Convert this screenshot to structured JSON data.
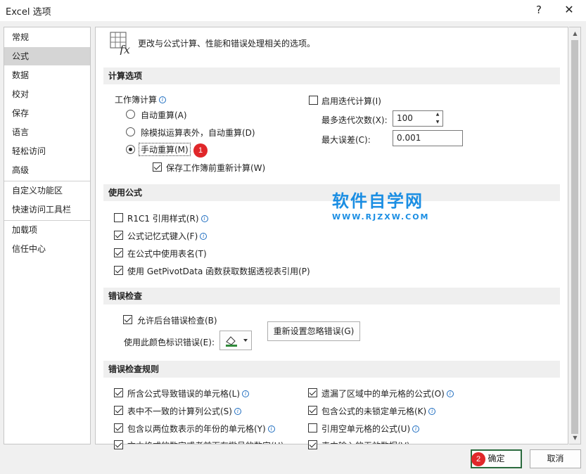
{
  "window": {
    "title": "Excel 选项",
    "help": "?",
    "close": "✕"
  },
  "sidebar": {
    "items": [
      {
        "label": "常规"
      },
      {
        "label": "公式"
      },
      {
        "label": "数据"
      },
      {
        "label": "校对"
      },
      {
        "label": "保存"
      },
      {
        "label": "语言"
      },
      {
        "label": "轻松访问"
      },
      {
        "label": "高级"
      },
      {
        "label": "自定义功能区"
      },
      {
        "label": "快速访问工具栏"
      },
      {
        "label": "加载项"
      },
      {
        "label": "信任中心"
      }
    ],
    "active_index": 1
  },
  "header": {
    "description": "更改与公式计算、性能和错误处理相关的选项。",
    "icon": "formula-fx-icon"
  },
  "calc": {
    "title": "计算选项",
    "workbook_label": "工作簿计算",
    "radio_auto": "自动重算(A)",
    "radio_auto_except": "除模拟运算表外，自动重算(D)",
    "radio_manual": "手动重算(M)",
    "selected": "manual",
    "save_recalc": "保存工作簿前重新计算(W)",
    "save_recalc_checked": true,
    "iter_enable": "启用迭代计算(I)",
    "iter_checked": false,
    "max_iter_label": "最多迭代次数(X):",
    "max_iter_value": "100",
    "max_change_label": "最大误差(C):",
    "max_change_value": "0.001"
  },
  "formulas": {
    "title": "使用公式",
    "r1c1": {
      "label": "R1C1 引用样式(R)",
      "checked": false
    },
    "autocomplete": {
      "label": "公式记忆式键入(F)",
      "checked": true
    },
    "table_names": {
      "label": "在公式中使用表名(T)",
      "checked": true
    },
    "getpivot": {
      "label": "使用 GetPivotData 函数获取数据透视表引用(P)",
      "checked": true
    }
  },
  "error_check": {
    "title": "错误检查",
    "background": {
      "label": "允许后台错误检查(B)",
      "checked": true
    },
    "color_label": "使用此颜色标识错误(E):",
    "color_value": "#2f8a3a",
    "reset_button": "重新设置忽略错误(G)"
  },
  "rules": {
    "title": "错误检查规则",
    "left": [
      {
        "label": "所含公式导致错误的单元格(L)",
        "checked": true
      },
      {
        "label": "表中不一致的计算列公式(S)",
        "checked": true
      },
      {
        "label": "包含以两位数表示的年份的单元格(Y)",
        "checked": true
      },
      {
        "label": "文本格式的数字或者前面有撇号的数字(H)",
        "checked": true
      }
    ],
    "right": [
      {
        "label": "遗漏了区域中的单元格的公式(O)",
        "checked": true
      },
      {
        "label": "包含公式的未锁定单元格(K)",
        "checked": true
      },
      {
        "label": "引用空单元格的公式(U)",
        "checked": false
      },
      {
        "label": "表中输入的无效数据(V)",
        "checked": true
      }
    ]
  },
  "buttons": {
    "ok": "确定",
    "cancel": "取消"
  },
  "annotations": {
    "badge1": "1",
    "badge2": "2"
  },
  "watermark": {
    "main": "软件自学网",
    "sub": "WWW.RJZXW.COM"
  }
}
